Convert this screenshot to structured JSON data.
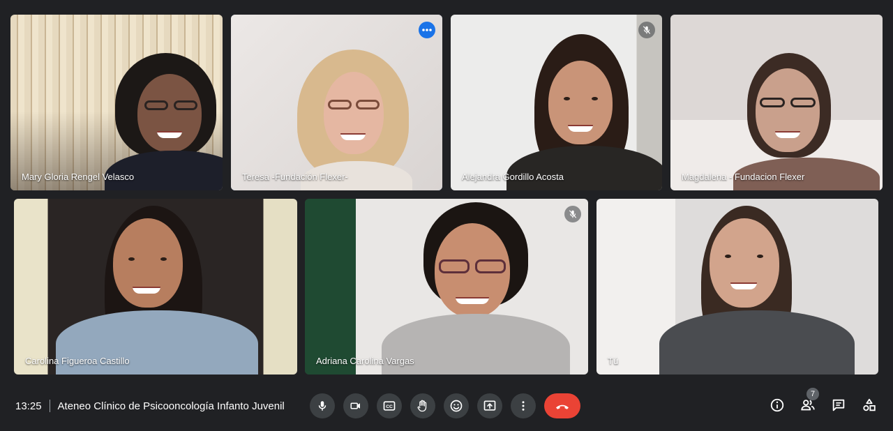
{
  "participants": [
    {
      "name": "Mary Gloria Rengel Velasco",
      "muted": false
    },
    {
      "name": "Teresa -Fundación Flexer-",
      "muted": false
    },
    {
      "name": "Alejandra Gordillo Acosta",
      "muted": true
    },
    {
      "name": "Magdalena - Fundacion Flexer",
      "muted": true
    },
    {
      "name": "Carolina Figueroa Castillo",
      "muted": true
    },
    {
      "name": "Adriana Carolina Vargas",
      "muted": true
    },
    {
      "name": "Tú",
      "muted": false
    }
  ],
  "meeting": {
    "time": "13:25",
    "title": "Ateneo Clínico de Psicooncología Infanto Juvenil"
  },
  "people_count": "7",
  "icons": {
    "mic": "microphone-icon",
    "camera": "camera-icon",
    "captions": "closed-captions-icon",
    "hand": "raise-hand-icon",
    "emoji": "emoji-icon",
    "present": "present-screen-icon",
    "more": "more-options-icon",
    "end": "end-call-icon",
    "info": "info-icon",
    "people": "people-icon",
    "chat": "chat-icon",
    "activities": "activities-icon"
  },
  "colors": {
    "background": "#202124",
    "control": "#3c4043",
    "end_call": "#ea4335",
    "active_outline": "#8ab4f8",
    "more_badge": "#1a73e8"
  }
}
